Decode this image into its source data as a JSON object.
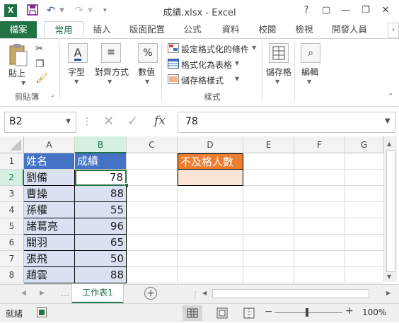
{
  "window": {
    "title": "成績.xlsx - Excel",
    "app_icon": "X",
    "controls": [
      "?",
      "▢",
      "—",
      "❐",
      "✕"
    ]
  },
  "ribbon_tabs": [
    "檔案",
    "常用",
    "插入",
    "版面配置",
    "公式",
    "資料",
    "校閱",
    "檢視",
    "開發人員"
  ],
  "ribbon": {
    "paste": "貼上",
    "clipboard_group": "剪貼簿",
    "font": "字型",
    "alignment": "對齊方式",
    "number": "數值",
    "number_icon": "%",
    "cond_format": "設定格式化的條件",
    "format_table": "格式化為表格",
    "cell_styles": "儲存格樣式",
    "styles_group": "樣式",
    "cells": "儲存格",
    "editing": "編輯"
  },
  "formula_bar": {
    "name_box": "B2",
    "fx": "fx",
    "value": "78"
  },
  "columns": [
    "A",
    "B",
    "C",
    "D",
    "E",
    "F",
    "G"
  ],
  "rows": [
    "1",
    "2",
    "3",
    "4",
    "5",
    "6",
    "7",
    "8"
  ],
  "table": {
    "header_name": "姓名",
    "header_score": "成績",
    "records": [
      {
        "name": "劉備",
        "score": "78"
      },
      {
        "name": "曹操",
        "score": "88"
      },
      {
        "name": "孫權",
        "score": "55"
      },
      {
        "name": "諸葛亮",
        "score": "96"
      },
      {
        "name": "關羽",
        "score": "65"
      },
      {
        "name": "張飛",
        "score": "50"
      },
      {
        "name": "趙雲",
        "score": "88"
      }
    ]
  },
  "fail_count_label": "不及格人數",
  "sheet_tab": "工作表1",
  "status": {
    "ready": "就緒",
    "zoom": "100%"
  },
  "colors": {
    "excel_green": "#217346",
    "header_blue": "#4472c4",
    "data_fill": "#d9e1f2",
    "orange": "#ed7d31",
    "light_orange": "#fce4d6"
  }
}
